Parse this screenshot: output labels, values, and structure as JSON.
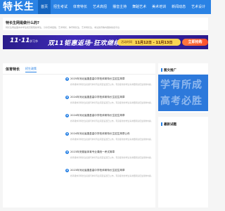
{
  "header": {
    "logo": "特长生",
    "nav": [
      {
        "label": "首页",
        "active": true
      },
      {
        "label": "招生考试"
      },
      {
        "label": "体育特长"
      },
      {
        "label": "艺术高招"
      },
      {
        "label": "播音主持"
      },
      {
        "label": "舞蹈艺术"
      },
      {
        "label": "美术培训"
      },
      {
        "label": "新闻动态"
      },
      {
        "label": "艺术设计"
      }
    ]
  },
  "intro": {
    "title": "特长生网是做什么的?",
    "text": "特长生网是面向中学生和高职院校学生，分享高考经验、艺术特长、体育特长生、艺术特长生、考试资讯等内容的综合平台"
  },
  "banner": {
    "big": "11·11",
    "tag": "学习节",
    "main": "双11钜惠返场·狂欢继续",
    "time_label": "活动时间",
    "time_value": "11月12日 - 11月13日",
    "button": "立即抢购"
  },
  "news": {
    "title": "体育特长",
    "tab": "招生政策",
    "items": [
      {
        "title": "2025年河北省唐县高中学校体育特长生招生简章",
        "desc": "各年级体育特长生名额与体育专业项目设置已公布，有意报考的学生请详细阅读招生简章内容。"
      },
      {
        "title": "2024年河北省唐县高中学校体育特长生招生简章",
        "desc": "各年级体育特长生名额与体育专业项目设置已公布，有意报考的学生请详细阅读招生简章内容。"
      },
      {
        "title": "2024年河北省唐县高中学校体育特长生招生简章",
        "desc": "各年级体育特长生名额与体育专业项目设置已公布，有意报考的学生请详细阅读招生简章内容。"
      },
      {
        "title": "2024年河北省唐县高中学校体育特长生招生简章公布",
        "desc": "各年级体育特长生名额与体育专业项目设置已公布，有意报考的学生请详细阅读招生简章内容。"
      },
      {
        "title": "2023年安徽省体育专业课统一考试简章",
        "desc": "各年级体育特长生名额与体育专业项目设置已公布，有意报考的学生请详细阅读招生简章内容。"
      },
      {
        "title": "2023年河北省唐县高中学校体育特长生招生简章",
        "desc": "各年级体育特长生名额与体育专业项目设置已公布，有意报考的学生请详细阅读招生简章内容。"
      }
    ]
  },
  "promo": {
    "title": "图文推广",
    "line1": "学有所成",
    "line2": "高考必胜"
  },
  "latest": {
    "title": "最新试题"
  },
  "colors": {
    "accent": "#2a82e4",
    "banner_bg": "#3a22a8",
    "banner_time": "#f9d552",
    "banner_button": "#ff5a30"
  }
}
